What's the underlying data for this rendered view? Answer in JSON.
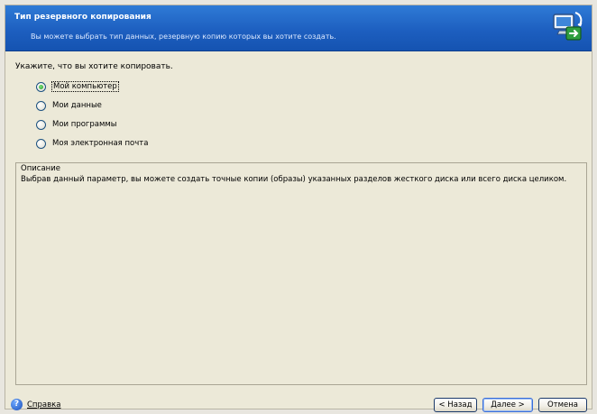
{
  "header": {
    "title": "Тип резервного копирования",
    "subtitle": "Вы можете выбрать тип данных, резервную копию которых вы хотите создать.",
    "logo_icon": "backup-wizard-icon"
  },
  "prompt": "Укажите, что вы хотите копировать.",
  "options": [
    {
      "label": "Мой компьютер",
      "checked": true
    },
    {
      "label": "Мои данные",
      "checked": false
    },
    {
      "label": "Мои программы",
      "checked": false
    },
    {
      "label": "Моя электронная почта",
      "checked": false
    }
  ],
  "description": {
    "legend": "Описание",
    "text": "Выбрав данный параметр, вы можете создать точные копии (образы) указанных разделов жесткого диска или всего диска целиком."
  },
  "footer": {
    "help_label": "Справка",
    "help_icon": "question-icon",
    "back_label": "< Назад",
    "next_label": "Далее >",
    "cancel_label": "Отмена"
  },
  "colors": {
    "header_blue": "#1d5fc0",
    "window_bg": "#ece9d8",
    "radio_checked": "#1f9a1f"
  }
}
